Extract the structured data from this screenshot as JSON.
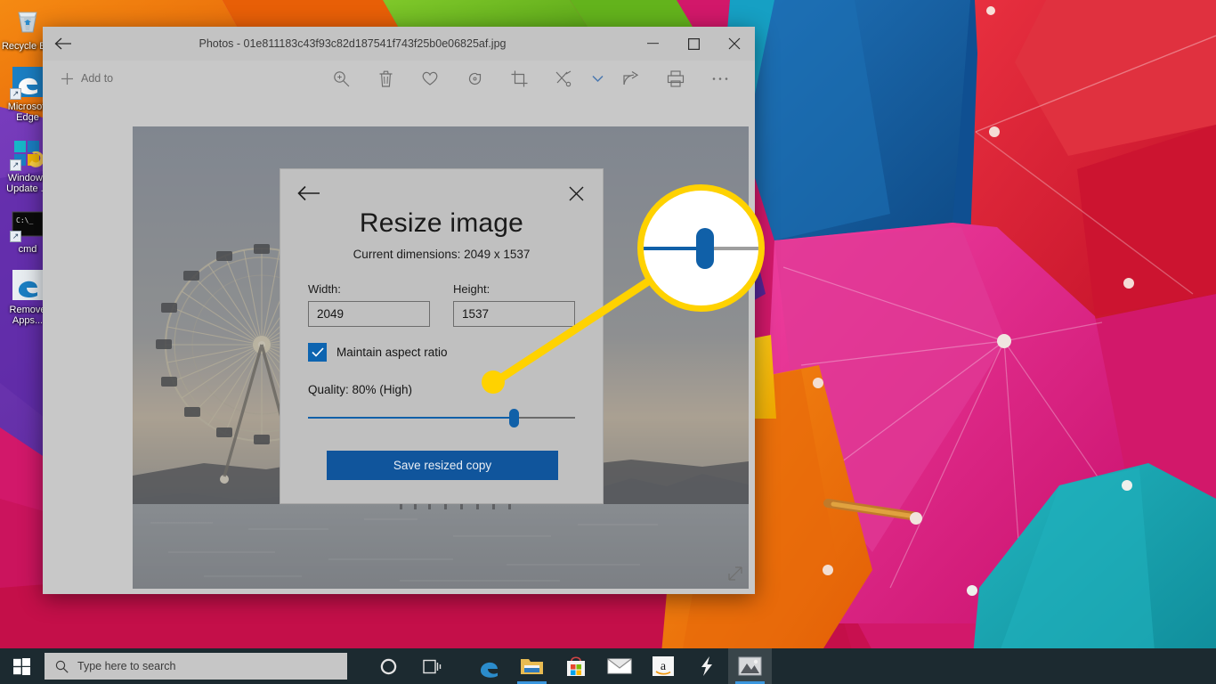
{
  "desktop": {
    "icons": [
      {
        "label": "Recycle Bin",
        "icon": "recycle-bin-icon",
        "shortcut": false
      },
      {
        "label": "Microsoft Edge",
        "icon": "edge-icon",
        "shortcut": true
      },
      {
        "label": "Windows Update ...",
        "icon": "windows-update-icon",
        "shortcut": true
      },
      {
        "label": "cmd",
        "icon": "command-prompt-icon",
        "shortcut": true
      },
      {
        "label": "Remove Apps...",
        "icon": "edge-icon",
        "shortcut": false
      }
    ],
    "wallpaper_colors": {
      "magenta": "#d2186a",
      "pink": "#e0359a",
      "red": "#e2233d",
      "blue": "#14569d",
      "teal": "#1aa8b4",
      "orange": "#ef7210",
      "crimson": "#c00632",
      "purple": "#6b2fa8"
    }
  },
  "window": {
    "title": "Photos - 01e811183c43f93c82d187541f743f25b0e06825af.jpg",
    "back_icon": "back-arrow-icon",
    "controls": {
      "minimize": "minimize-icon",
      "maximize": "maximize-icon",
      "close": "close-icon"
    },
    "toolbar": {
      "add_to_label": "Add to",
      "add_to_icon": "plus-icon",
      "items": [
        {
          "name": "zoom-icon",
          "title": "Zoom"
        },
        {
          "name": "delete-icon",
          "title": "Delete"
        },
        {
          "name": "heart-icon",
          "title": "Add to favorites"
        },
        {
          "name": "rotate-icon",
          "title": "Rotate"
        },
        {
          "name": "crop-icon",
          "title": "Crop and rotate"
        },
        {
          "name": "edit-create-icon",
          "title": "Edit & Create"
        },
        {
          "name": "chevron-down-icon",
          "title": "More edit options"
        },
        {
          "name": "share-icon",
          "title": "Share"
        },
        {
          "name": "print-icon",
          "title": "Print"
        },
        {
          "name": "more-icon",
          "title": "See more"
        }
      ]
    },
    "photo": {
      "alt": "Ferris wheel on a pier at dusk over water with mountains",
      "resize_corner_icon": "resize-diagonal-icon"
    }
  },
  "dialog": {
    "back_icon": "back-arrow-icon",
    "close_icon": "close-icon",
    "title": "Resize image",
    "subtitle": "Current dimensions: 2049 x 1537",
    "width_label": "Width:",
    "width_value": "2049",
    "height_label": "Height:",
    "height_value": "1537",
    "aspect_label": "Maintain aspect ratio",
    "aspect_checked": true,
    "check_icon": "checkmark-icon",
    "quality_label": "Quality: 80% (High)",
    "quality_percent": 80,
    "slider_fill_percent": 77,
    "save_label": "Save resized copy",
    "accent_color": "#10559c"
  },
  "callout": {
    "type": "magnifier-circle",
    "ring_color": "#ffd200",
    "target": "quality-slider-thumb"
  },
  "taskbar": {
    "start_icon": "windows-start-icon",
    "search": {
      "icon": "search-icon",
      "placeholder": "Type here to search"
    },
    "cortana_icon": "cortana-circle-icon",
    "taskview_icon": "task-view-icon",
    "apps": [
      {
        "name": "edge-taskbar-icon",
        "label": "Microsoft Edge",
        "active": false,
        "open": false
      },
      {
        "name": "file-explorer-taskbar-icon",
        "label": "File Explorer",
        "active": false,
        "open": true
      },
      {
        "name": "microsoft-store-taskbar-icon",
        "label": "Microsoft Store",
        "active": false,
        "open": false
      },
      {
        "name": "mail-taskbar-icon",
        "label": "Mail",
        "active": false,
        "open": false
      },
      {
        "name": "amazon-taskbar-icon",
        "label": "Amazon",
        "active": false,
        "open": false
      },
      {
        "name": "lightning-taskbar-icon",
        "label": "App",
        "active": false,
        "open": false
      },
      {
        "name": "photos-taskbar-icon",
        "label": "Photos",
        "active": true,
        "open": true
      }
    ]
  }
}
